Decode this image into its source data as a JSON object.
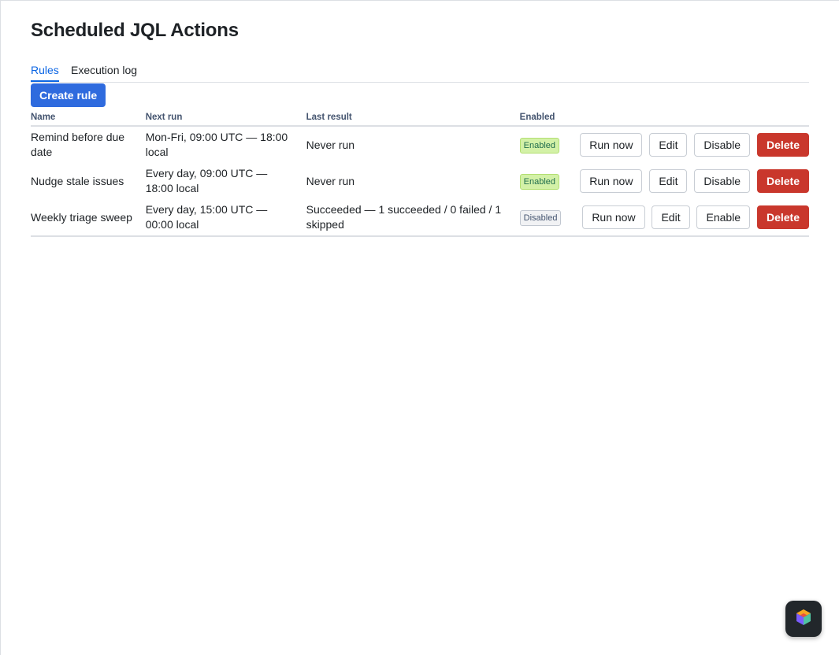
{
  "page": {
    "title": "Scheduled JQL Actions"
  },
  "tabs": [
    {
      "label": "Rules",
      "active": true
    },
    {
      "label": "Execution log",
      "active": false
    }
  ],
  "toolbar": {
    "create_label": "Create rule"
  },
  "table": {
    "columns": [
      "Name",
      "Next run",
      "Last result",
      "Enabled",
      ""
    ],
    "rows": [
      {
        "name": "Remind before due date",
        "next_run": "Mon-Fri, 09:00 UTC — 18:00 local",
        "last_result": "Never run",
        "status": "Enabled",
        "actions": {
          "run": "Run now",
          "edit": "Edit",
          "toggle": "Disable",
          "delete": "Delete"
        }
      },
      {
        "name": "Nudge stale issues",
        "next_run": "Every day, 09:00 UTC — 18:00 local",
        "last_result": "Never run",
        "status": "Enabled",
        "actions": {
          "run": "Run now",
          "edit": "Edit",
          "toggle": "Disable",
          "delete": "Delete"
        }
      },
      {
        "name": "Weekly triage sweep",
        "next_run": "Every day, 15:00 UTC — 00:00 local",
        "last_result": "Succeeded — 1 succeeded / 0 failed / 1 skipped",
        "status": "Disabled",
        "actions": {
          "run": "Run now",
          "edit": "Edit",
          "toggle": "Enable",
          "delete": "Delete"
        }
      }
    ]
  },
  "fab": {
    "icon": "app-logo-icon"
  },
  "colors": {
    "primary": "#2f6bde",
    "danger": "#c9372c",
    "enabled_badge": "#d3f1a7",
    "disabled_badge": "#f1f2f4",
    "active_tab": "#0c66e4"
  }
}
